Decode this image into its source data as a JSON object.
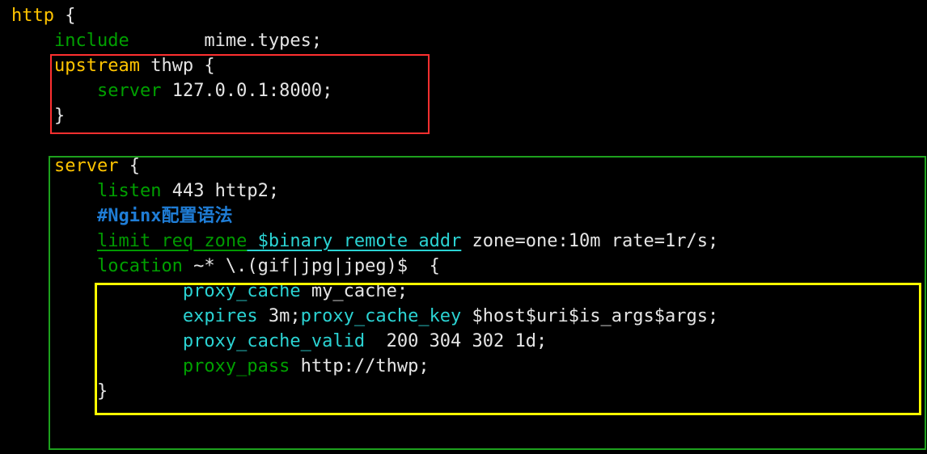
{
  "line1": {
    "http": "http",
    "brace": " {"
  },
  "line2": {
    "include": "include",
    "mime": "mime.types",
    "semi": ";"
  },
  "line3": {
    "upstream": "upstream",
    "name": " thwp {"
  },
  "line4": {
    "server": "server",
    "addr": " 127.0.0.1:8000;"
  },
  "line5": {
    "close": "}"
  },
  "line7": {
    "server": "server",
    "brace": " {"
  },
  "line8": {
    "listen": "listen",
    "rest": " 443 http2;"
  },
  "line9": {
    "hash": "#",
    "text": "Nginx配置语法"
  },
  "line10": {
    "lrz": "limit_req_zone",
    "var": " $binary_remote_addr",
    "rest": " zone=one:10m rate=1r/s;"
  },
  "line11": {
    "location": "location",
    "pat": " ~* \\.(gif|jpg|jpeg)$  {"
  },
  "line12": {
    "d": "proxy_cache",
    "v": " my_cache;"
  },
  "line13": {
    "d1": "expires",
    "v1": " 3m;",
    "d2": "proxy_cache_key",
    "v2": " $host$uri$is_args$args;"
  },
  "line14": {
    "d": "proxy_cache_valid",
    "v": "  200 304 302 1d;"
  },
  "line15": {
    "d": "proxy_pass",
    "v": " http://thwp;"
  },
  "line16": {
    "close": "}"
  }
}
